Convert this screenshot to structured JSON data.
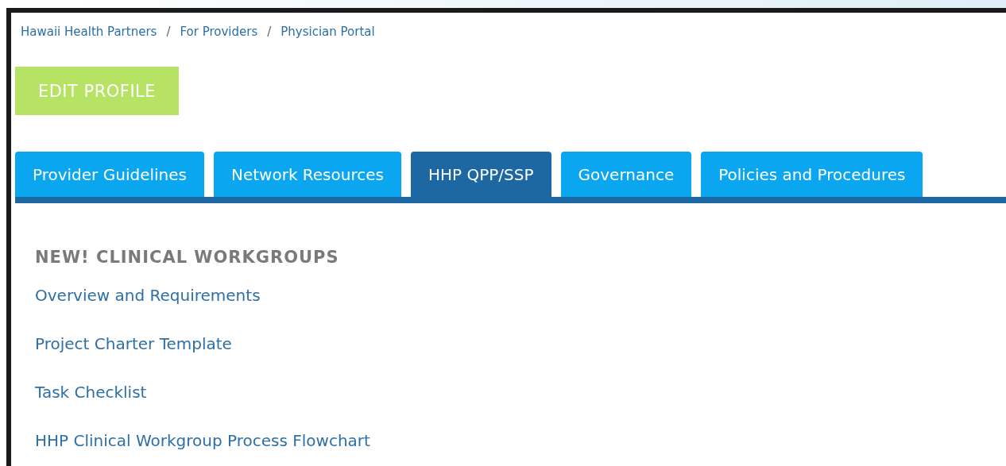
{
  "breadcrumb": [
    "Hawaii Health Partners",
    "For Providers",
    "Physician Portal"
  ],
  "breadcrumb_separator": "/",
  "edit_button": "EDIT PROFILE",
  "tabs": [
    {
      "label": "Provider Guidelines",
      "selected": false
    },
    {
      "label": "Network Resources",
      "selected": false
    },
    {
      "label": "HHP QPP/SSP",
      "selected": true
    },
    {
      "label": "Governance",
      "selected": false
    },
    {
      "label": "Policies and Procedures",
      "selected": false
    }
  ],
  "section": {
    "heading": "NEW! CLINICAL WORKGROUPS",
    "links": [
      "Overview and Requirements",
      "Project Charter Template",
      "Task Checklist",
      "HHP Clinical Workgroup Process Flowchart"
    ]
  }
}
